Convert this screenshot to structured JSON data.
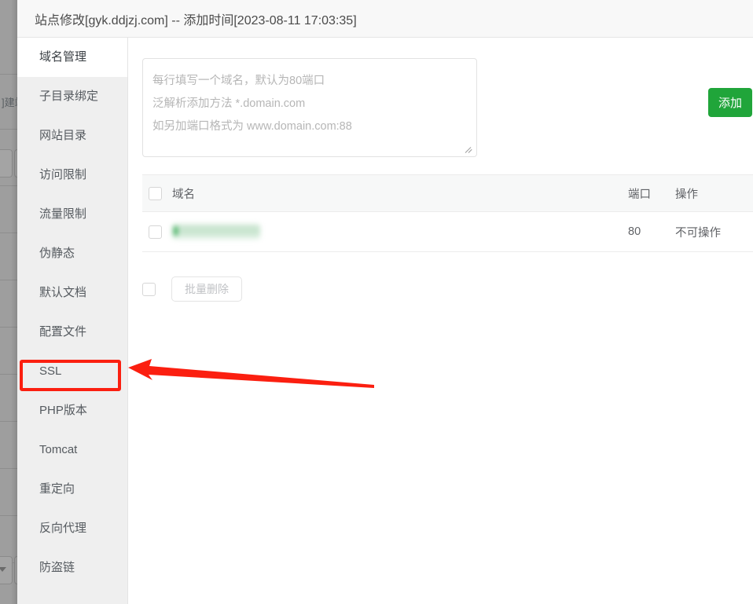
{
  "window": {
    "title": "站点修改[gyk.ddjzj.com] -- 添加时间[2023-08-11 17:03:35]"
  },
  "sidebar": {
    "items": [
      {
        "label": "域名管理",
        "active": true
      },
      {
        "label": "子目录绑定",
        "active": false
      },
      {
        "label": "网站目录",
        "active": false
      },
      {
        "label": "访问限制",
        "active": false
      },
      {
        "label": "流量限制",
        "active": false
      },
      {
        "label": "伪静态",
        "active": false
      },
      {
        "label": "默认文档",
        "active": false
      },
      {
        "label": "配置文件",
        "active": false
      },
      {
        "label": "SSL",
        "active": false
      },
      {
        "label": "PHP版本",
        "active": false
      },
      {
        "label": "Tomcat",
        "active": false
      },
      {
        "label": "重定向",
        "active": false
      },
      {
        "label": "反向代理",
        "active": false
      },
      {
        "label": "防盗链",
        "active": false
      }
    ]
  },
  "main": {
    "domain_input": {
      "value": "",
      "placeholder": "每行填写一个域名，默认为80端口\n泛解析添加方法 *.domain.com\n如另加端口格式为 www.domain.com:88"
    },
    "add_button_label": "添加",
    "table": {
      "headers": {
        "domain": "域名",
        "port": "端口",
        "operation": "操作"
      },
      "rows": [
        {
          "domain": "",
          "port": "80",
          "operation": "不可操作"
        }
      ]
    },
    "bulk_delete_label": "批量删除"
  },
  "annotations": {
    "highlight_target": "SSL",
    "arrow_color": "#fb1f10",
    "box_color": "#fb1f10"
  },
  "backdrop": {
    "partial_text": "]建站"
  },
  "colors": {
    "accent_green": "#20a53a",
    "header_bg": "#f8f8f8",
    "sidebar_bg": "#efefef",
    "annotation_red": "#fb1f10"
  }
}
